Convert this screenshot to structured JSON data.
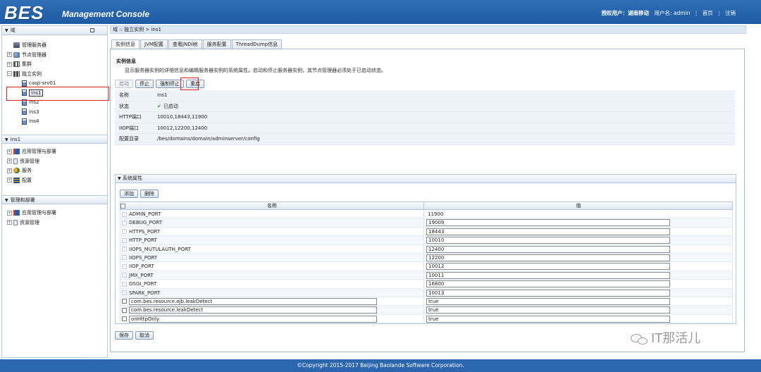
{
  "header": {
    "logo": "BES",
    "subtitle": "Management Console",
    "license_user": "授权用户：湖南移动",
    "user": "用户名: admin",
    "home": "首页",
    "logout": "注销"
  },
  "left_panels": {
    "domain": {
      "title": "域",
      "items": [
        {
          "label": "管理服务器"
        },
        {
          "label": "节点管理器"
        },
        {
          "label": "集群"
        },
        {
          "label": "独立实例"
        },
        {
          "label": "casp-srv01"
        },
        {
          "label": "ins1"
        },
        {
          "label": "ins2"
        },
        {
          "label": "ins3"
        },
        {
          "label": "ins4"
        }
      ]
    },
    "instance": {
      "title": "ins1",
      "items": [
        {
          "label": "应用管理与部署"
        },
        {
          "label": "资源管理"
        },
        {
          "label": "服务"
        },
        {
          "label": "配置"
        }
      ]
    },
    "manage": {
      "title": "管理和部署",
      "items": [
        {
          "label": "应用管理与部署"
        },
        {
          "label": "资源管理"
        }
      ]
    }
  },
  "breadcrumb": "域 :: 独立实例 > ins1",
  "tabs": [
    {
      "label": "实例信息"
    },
    {
      "label": "JVM配置"
    },
    {
      "label": "查看JNDI树"
    },
    {
      "label": "服务配置"
    },
    {
      "label": "ThreadDump信息"
    }
  ],
  "instance_info": {
    "title": "实例信息",
    "description": "显示服务器实例的详细信息和编辑服务器实例的系统属性。启动和停止服务器实例，其节点管理器必须处于已启动状态。",
    "buttons": {
      "start": "启动",
      "stop": "停止",
      "force_stop": "强制停止",
      "restart": "重启"
    },
    "rows": [
      {
        "key": "名称",
        "value": "ins1"
      },
      {
        "key": "状态",
        "value": "已启动"
      },
      {
        "key": "HTTP端口",
        "value": "10010,18443,11900"
      },
      {
        "key": "IIOP端口",
        "value": "10012,12200,12400"
      },
      {
        "key": "配置目录",
        "value": "/bes/domains/domain/adminserver/config"
      }
    ]
  },
  "system_props": {
    "title": "系统属性",
    "add": "添加",
    "delete": "删除",
    "col_name": "名称",
    "col_value": "值",
    "rows": [
      {
        "name": "ADMIN_PORT",
        "value": "11900"
      },
      {
        "name": "DEBUG_PORT",
        "value": "19009"
      },
      {
        "name": "HTTPS_PORT",
        "value": "18443"
      },
      {
        "name": "HTTP_PORT",
        "value": "10010"
      },
      {
        "name": "IIOPS_MUTULAUTH_PORT",
        "value": "12400"
      },
      {
        "name": "IIOPS_PORT",
        "value": "12200"
      },
      {
        "name": "IIOP_PORT",
        "value": "10012"
      },
      {
        "name": "JMX_PORT",
        "value": "10011"
      },
      {
        "name": "OSGI_PORT",
        "value": "16800"
      },
      {
        "name": "SPARK_PORT",
        "value": "10013"
      },
      {
        "name": "com.bes.resource.ejb.leakDetect",
        "value": "true"
      },
      {
        "name": "com.bes.resource.leakDetect",
        "value": "true"
      },
      {
        "name": "onHttpOnly",
        "value": "true"
      }
    ]
  },
  "save": "保存",
  "cancel": "取消",
  "footer": "©Copyright 2015-2017 Beijing Baolande Software Corporation.",
  "watermark": "IT那活儿"
}
